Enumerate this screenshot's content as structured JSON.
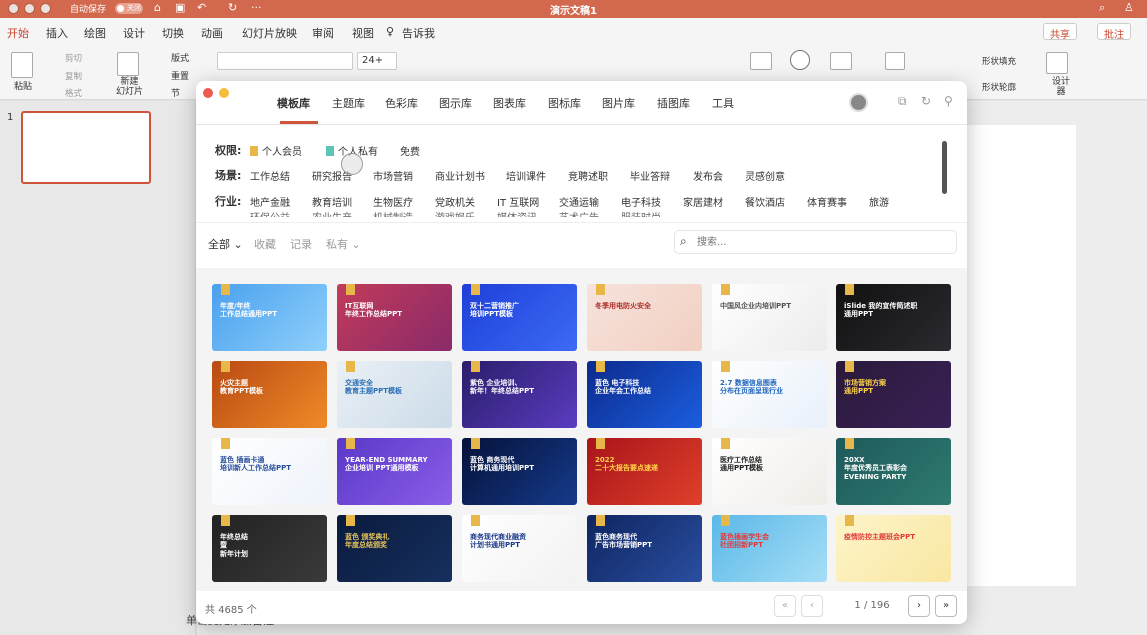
{
  "titlebar": {
    "autosave": "自动保存",
    "toggle": "关闭",
    "title": "演示文稿1"
  },
  "tabs": [
    "开始",
    "插入",
    "绘图",
    "设计",
    "切换",
    "动画",
    "幻灯片放映",
    "审阅",
    "视图"
  ],
  "tell_me": "告诉我",
  "share": "共享",
  "comments": "批注",
  "ribbon": {
    "paste": "粘贴",
    "cut": "剪切",
    "copy": "复制",
    "format": "格式",
    "new_slide": "新建\n幻灯片",
    "layout": "版式",
    "reset": "重置",
    "section": "节",
    "font_size": "24+",
    "shape_fill": "形状填充",
    "shape_outline": "形状轮廓",
    "design": "设计\n器"
  },
  "slide_number": "1",
  "status": "单击此处添加备注",
  "dialog": {
    "tabs": [
      "模板库",
      "主题库",
      "色彩库",
      "图示库",
      "图表库",
      "图标库",
      "图片库",
      "插图库",
      "工具"
    ],
    "filters": {
      "perm_label": "权限:",
      "perm": [
        "个人会员",
        "个人私有",
        "免费"
      ],
      "scene_label": "场景:",
      "scene": [
        "工作总结",
        "研究报告",
        "市场营销",
        "商业计划书",
        "培训课件",
        "竞聘述职",
        "毕业答辩",
        "发布会",
        "灵感创意"
      ],
      "industry_label": "行业:",
      "industry": [
        "地产金融",
        "教育培训",
        "生物医疗",
        "党政机关",
        "IT 互联网",
        "交通运输",
        "电子科技",
        "家居建材",
        "餐饮酒店",
        "体育赛事",
        "旅游"
      ],
      "industry_cut": [
        "环保公益",
        "农业生产",
        "机械制造",
        "游戏娱乐",
        "媒体资讯",
        "艺术广告",
        "服装时尚"
      ]
    },
    "subfilters": [
      "全部",
      "收藏",
      "记录",
      "私有"
    ],
    "search_placeholder": "搜索...",
    "total": "共 4685 个",
    "page": "1 / 196",
    "cards": [
      {
        "text": "年度/年终\n工作总结通用PPT",
        "bg": "linear-gradient(135deg,#4aa0ee,#8fd0fb)",
        "color": "#ffffff"
      },
      {
        "text": "IT互联网\n年终工作总结PPT",
        "bg": "linear-gradient(135deg,#c23b5a,#8a2a6a)",
        "color": "#ffffff"
      },
      {
        "text": "双十二营销推广\n培训PPT模板",
        "bg": "linear-gradient(135deg,#1e3fd8,#3c6af5)",
        "color": "#ffffff"
      },
      {
        "text": "冬季用电防火安全",
        "bg": "linear-gradient(135deg,#f6e3dc,#f2cfc2)",
        "color": "#b0302a"
      },
      {
        "text": "中国风企业内培训PPT",
        "bg": "linear-gradient(135deg,#ffffff,#ececec)",
        "color": "#555555"
      },
      {
        "text": "iSlide 我的宣传简述职\n通用PPT",
        "bg": "linear-gradient(135deg,#111111,#2a2a30)",
        "color": "#ffffff"
      },
      {
        "text": "火灾主题\n教育PPT模板",
        "bg": "linear-gradient(135deg,#b84a12,#f08a28)",
        "color": "#ffffff"
      },
      {
        "text": "交通安全\n教育主题PPT模板",
        "bg": "linear-gradient(135deg,#eaf0f6,#cbdbe8)",
        "color": "#2a6fb5"
      },
      {
        "text": "紫色 企业培训、\n新年！年终总结PPT",
        "bg": "linear-gradient(135deg,#2b1d6a,#5a3cc0)",
        "color": "#ffffff"
      },
      {
        "text": "蓝色 电子科技\n企业年会工作总结",
        "bg": "linear-gradient(135deg,#0c2a8c,#1b5ee0)",
        "color": "#ffffff"
      },
      {
        "text": "2.7 数据信息图表\n分布在页面呈现行业",
        "bg": "linear-gradient(135deg,#ffffff,#e8f0fa)",
        "color": "#2266bb"
      },
      {
        "text": "市场营销方案\n通用PPT",
        "bg": "linear-gradient(135deg,#2a1a3a,#3a2056)",
        "color": "#ffd24a"
      },
      {
        "text": "蓝色 插画卡通\n培训新人工作总结PPT",
        "bg": "linear-gradient(135deg,#ffffff,#eef3fb)",
        "color": "#2a4e9a"
      },
      {
        "text": "YEAR-END SUMMARY\n企业培训 PPT通用模板",
        "bg": "linear-gradient(135deg,#5a38c8,#8a5ee8)",
        "color": "#ffffff"
      },
      {
        "text": "蓝色 商务现代\n计算机通用培训PPT",
        "bg": "linear-gradient(135deg,#06123a,#153a8a)",
        "color": "#ffffff"
      },
      {
        "text": "2022\n二十大报告要点速递",
        "bg": "linear-gradient(135deg,#a8141a,#e0402a)",
        "color": "#ffd24a"
      },
      {
        "text": "医疗工作总结\n通用PPT模板",
        "bg": "linear-gradient(135deg,#ffffff,#f0ece8)",
        "color": "#222222"
      },
      {
        "text": "20XX\n年度优秀员工表彰会\nEVENING PARTY",
        "bg": "linear-gradient(135deg,#1e5a5a,#2e7a70)",
        "color": "#ffffff"
      },
      {
        "text": "年终总结\n暨\n新年计划",
        "bg": "linear-gradient(135deg,#222222,#3a3a3a)",
        "color": "#ffffff"
      },
      {
        "text": "蓝色 颁奖典礼\n年度总结颁奖",
        "bg": "linear-gradient(135deg,#0a1a3e,#16305e)",
        "color": "#e6c25a"
      },
      {
        "text": "商务现代商业融资\n计划书通用PPT",
        "bg": "linear-gradient(135deg,#ffffff,#f2f2f2)",
        "color": "#1b3a8a"
      },
      {
        "text": "蓝色商务现代\n广告市场营销PPT",
        "bg": "linear-gradient(135deg,#0f2560,#2a4ea0)",
        "color": "#ffffff"
      },
      {
        "text": "蓝色插画学生会\n社团招新PPT",
        "bg": "linear-gradient(135deg,#5ab8e8,#a6def6)",
        "color": "#e03a3a"
      },
      {
        "text": "疫情防控主题班会PPT",
        "bg": "linear-gradient(135deg,#fdf4c8,#f9e7a2)",
        "color": "#e03a3a"
      }
    ]
  }
}
